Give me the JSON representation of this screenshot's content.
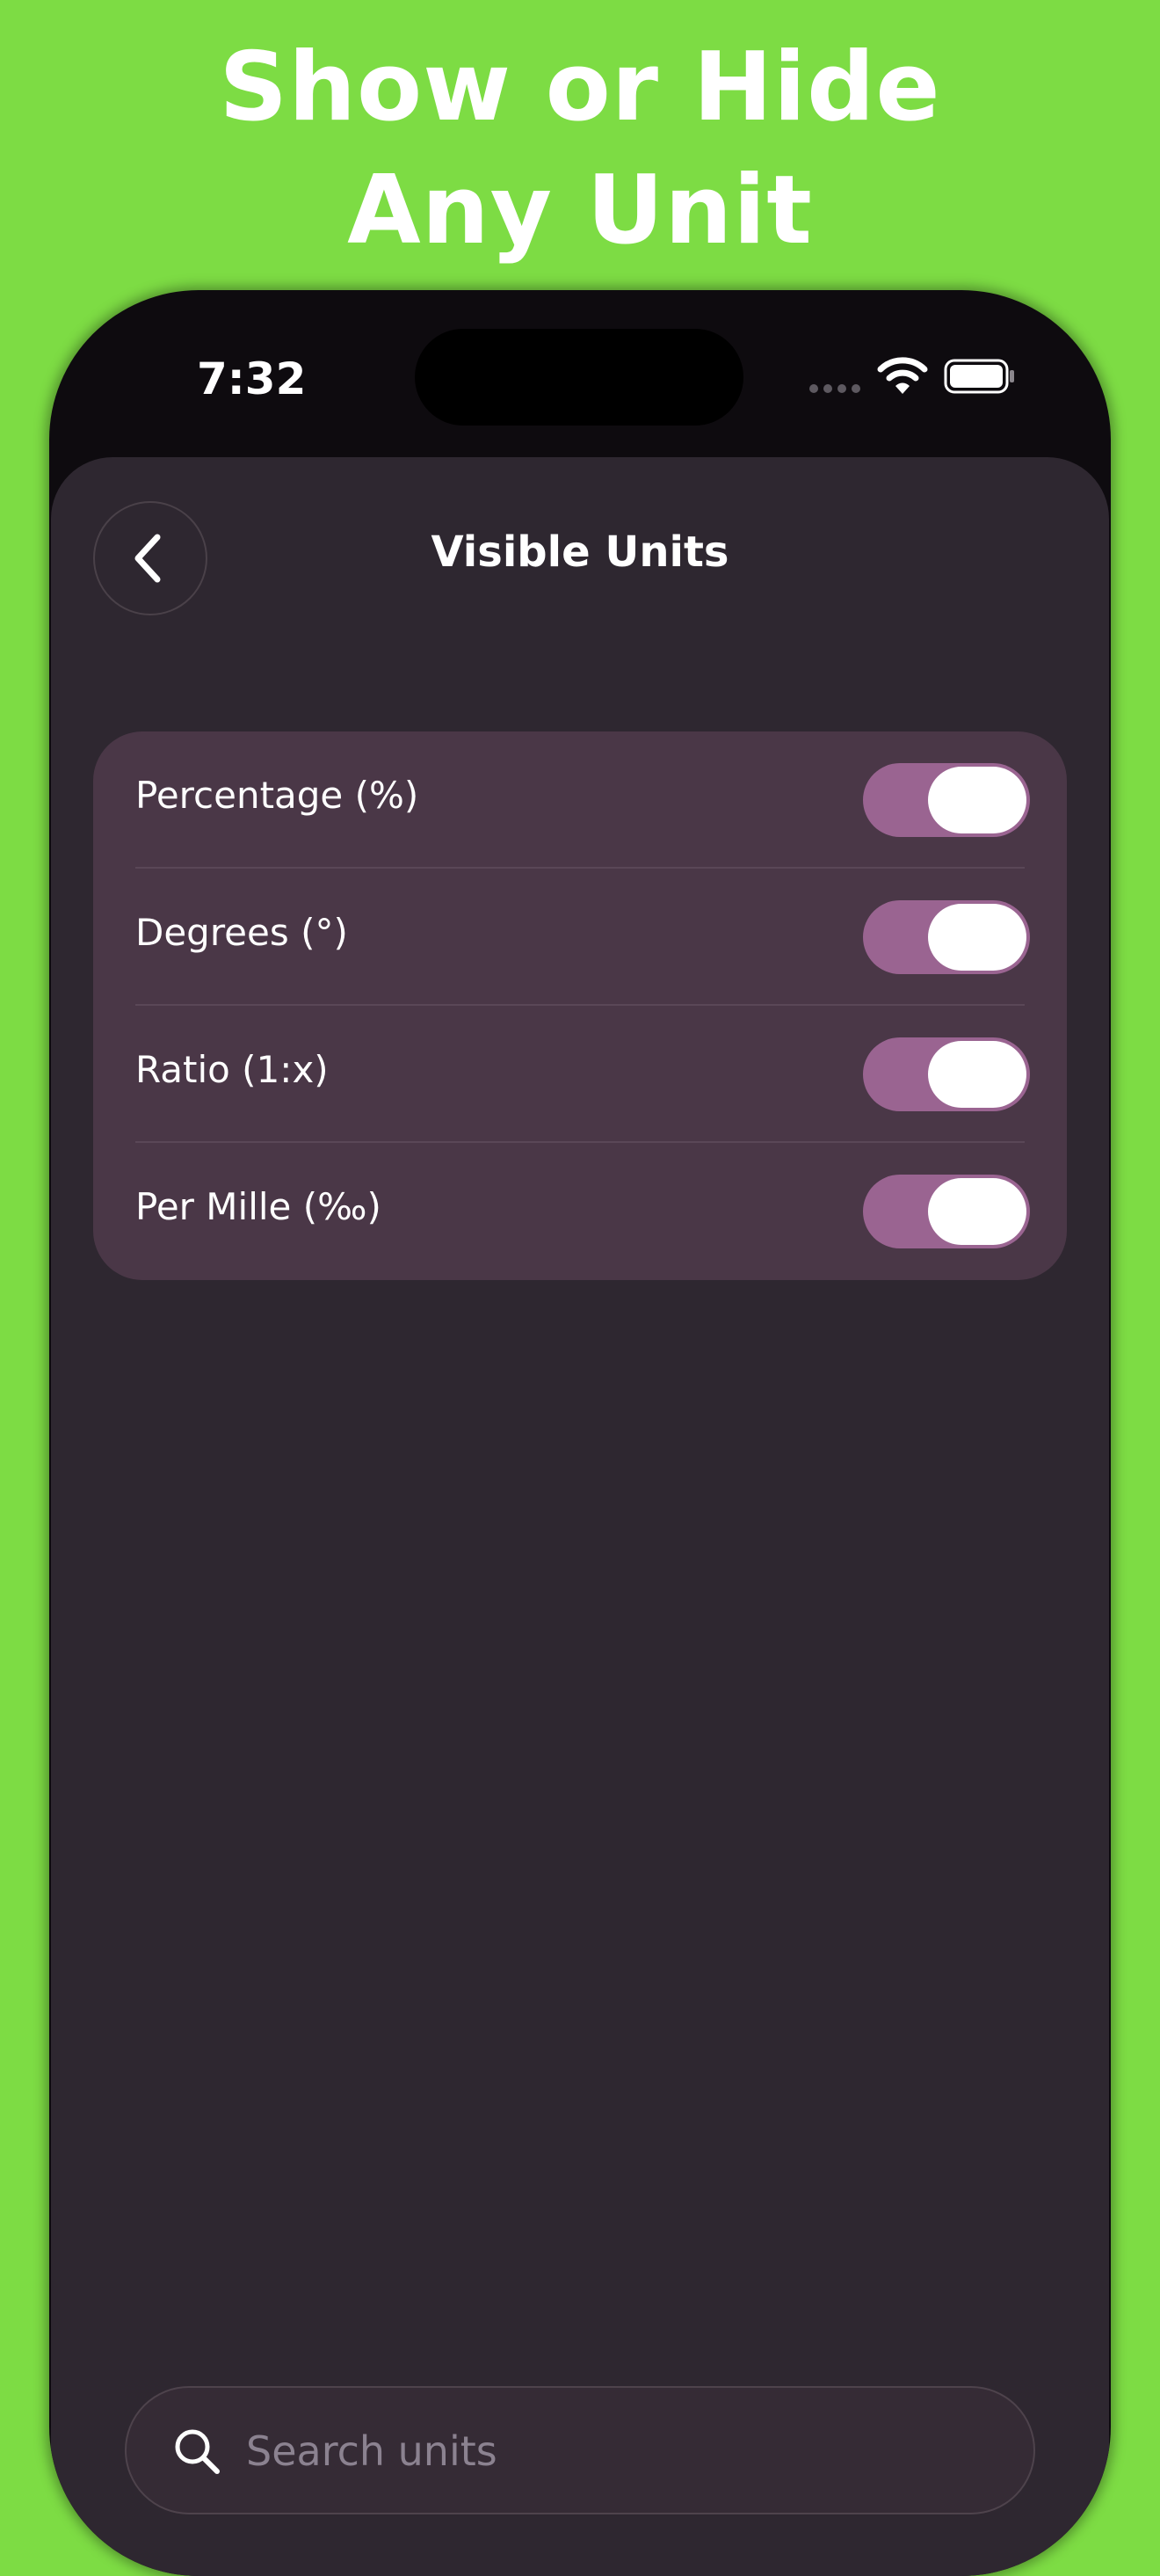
{
  "promo": {
    "line1": "Show or Hide",
    "line2": "Any Unit"
  },
  "status_bar": {
    "time": "7:32",
    "icons": [
      "cellular-dots-icon",
      "wifi-icon",
      "battery-icon"
    ]
  },
  "nav": {
    "title": "Visible Units",
    "back_icon": "chevron-left-icon"
  },
  "units": [
    {
      "label": "Percentage (%)",
      "visible": true
    },
    {
      "label": "Degrees (°)",
      "visible": true
    },
    {
      "label": "Ratio (1:x)",
      "visible": true
    },
    {
      "label": "Per Mille (‰)",
      "visible": true
    }
  ],
  "search": {
    "placeholder": "Search units",
    "value": "",
    "icon": "magnifier-icon"
  },
  "colors": {
    "background": "#7ddc44",
    "sheet": "#2e2730",
    "card": "#4a3747",
    "toggle_on": "#9a6491"
  }
}
